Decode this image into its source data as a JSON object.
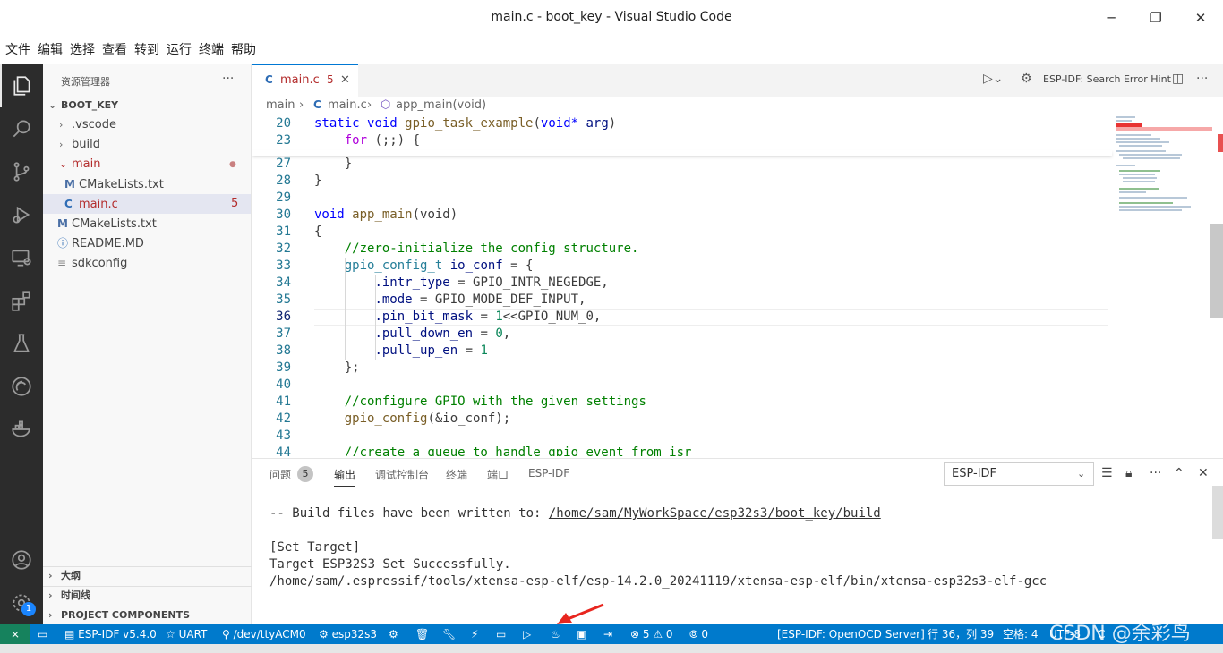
{
  "window": {
    "title": "main.c - boot_key - Visual Studio Code"
  },
  "menu": [
    "文件",
    "编辑",
    "选择",
    "查看",
    "转到",
    "运行",
    "终端",
    "帮助"
  ],
  "activity_badge": "1",
  "sidebar": {
    "title": "资源管理器",
    "more": "···",
    "root": "BOOT_KEY",
    "items": [
      {
        "label": ".vscode",
        "chev": "›"
      },
      {
        "label": "build",
        "chev": "›"
      },
      {
        "label": "main",
        "chev": "⌄",
        "dot": "●"
      },
      {
        "label": "CMakeLists.txt",
        "icon": "M"
      },
      {
        "label": "main.c",
        "icon": "C",
        "badge": "5"
      },
      {
        "label": "CMakeLists.txt",
        "icon": "M"
      },
      {
        "label": "README.MD",
        "icon": "ⓘ"
      },
      {
        "label": "sdkconfig",
        "icon": "≡"
      }
    ],
    "sections": [
      "大纲",
      "时间线",
      "PROJECT COMPONENTS"
    ]
  },
  "tabs": {
    "active": {
      "icon": "C",
      "label": "main.c",
      "badge": "5",
      "close": "✕"
    },
    "actions_label": "ESP-IDF: Search Error Hint"
  },
  "breadcrumb": {
    "part1": "main",
    "sep": "›",
    "icon": "C",
    "part2": "main.c",
    "part3": "app_main(void)"
  },
  "editor": {
    "line_numbers": [
      "20",
      "23",
      "27",
      "28",
      "29",
      "30",
      "31",
      "32",
      "33",
      "34",
      "35",
      "36",
      "37",
      "38",
      "39",
      "40",
      "41",
      "42",
      "43",
      "44"
    ],
    "tokens": {
      "static": "static",
      "void": "void",
      "gpio_task_example": "gpio_task_example",
      "void_star": "void*",
      "arg": "arg",
      "for": "for",
      "for_rest": " (;;) {",
      "brace_close": "}",
      "app_main": "app_main",
      "paren_void": "(void)",
      "brace_open": "{",
      "comment1": "//zero-initialize the config structure.",
      "gpio_config_t": "gpio_config_t",
      "io_conf": "io_conf",
      "eq_brace": " = {",
      "intr_type": ".intr_type",
      "intr_val": " = GPIO_INTR_NEGEDGE,",
      "mode": ".mode",
      "mode_val": " = GPIO_MODE_DEF_INPUT,",
      "pin_bit_mask": ".pin_bit_mask",
      "pin_eq": " = ",
      "one": "1",
      "pin_rest": "<<GPIO_NUM_0,",
      "pull_down_en": ".pull_down_en",
      "zero": "0",
      "comma": ",",
      "pull_up_en": ".pull_up_en",
      "one2": "1",
      "close_struct": "};",
      "comment2": "//configure GPIO with the given settings",
      "gpio_config": "gpio_config",
      "gpio_config_args": "(&io_conf);",
      "comment3": "//create a queue to handle gpio event from isr"
    }
  },
  "panel": {
    "tabs": [
      "问题",
      "输出",
      "调试控制台",
      "终端",
      "端口",
      "ESP-IDF"
    ],
    "problems_count": "5",
    "selected_output": "ESP-IDF",
    "output_lines": [
      "-- Build files have been written to: ",
      "/home/sam/MyWorkSpace/esp32s3/boot_key/build",
      "[Set Target]",
      "Target ESP32S3 Set Successfully.",
      "/home/sam/.espressif/tools/xtensa-esp-elf/esp-14.2.0_20241119/xtensa-esp-elf/bin/xtensa-esp32s3-elf-gcc"
    ]
  },
  "statusbar": {
    "remote": "⨯",
    "idf": "ESP-IDF v5.4.0",
    "uart": "UART",
    "port": "/dev/ttyACM0",
    "target": "esp32s3",
    "problems": "⊗ 5 ⚠ 0",
    "radio": "0",
    "openocd": "[ESP-IDF: OpenOCD Server]",
    "position": "行 36，列 39",
    "spaces": "空格: 4",
    "encoding": "UTF-8",
    "lang": "C"
  },
  "watermark": "CSDN @余彩鸟"
}
